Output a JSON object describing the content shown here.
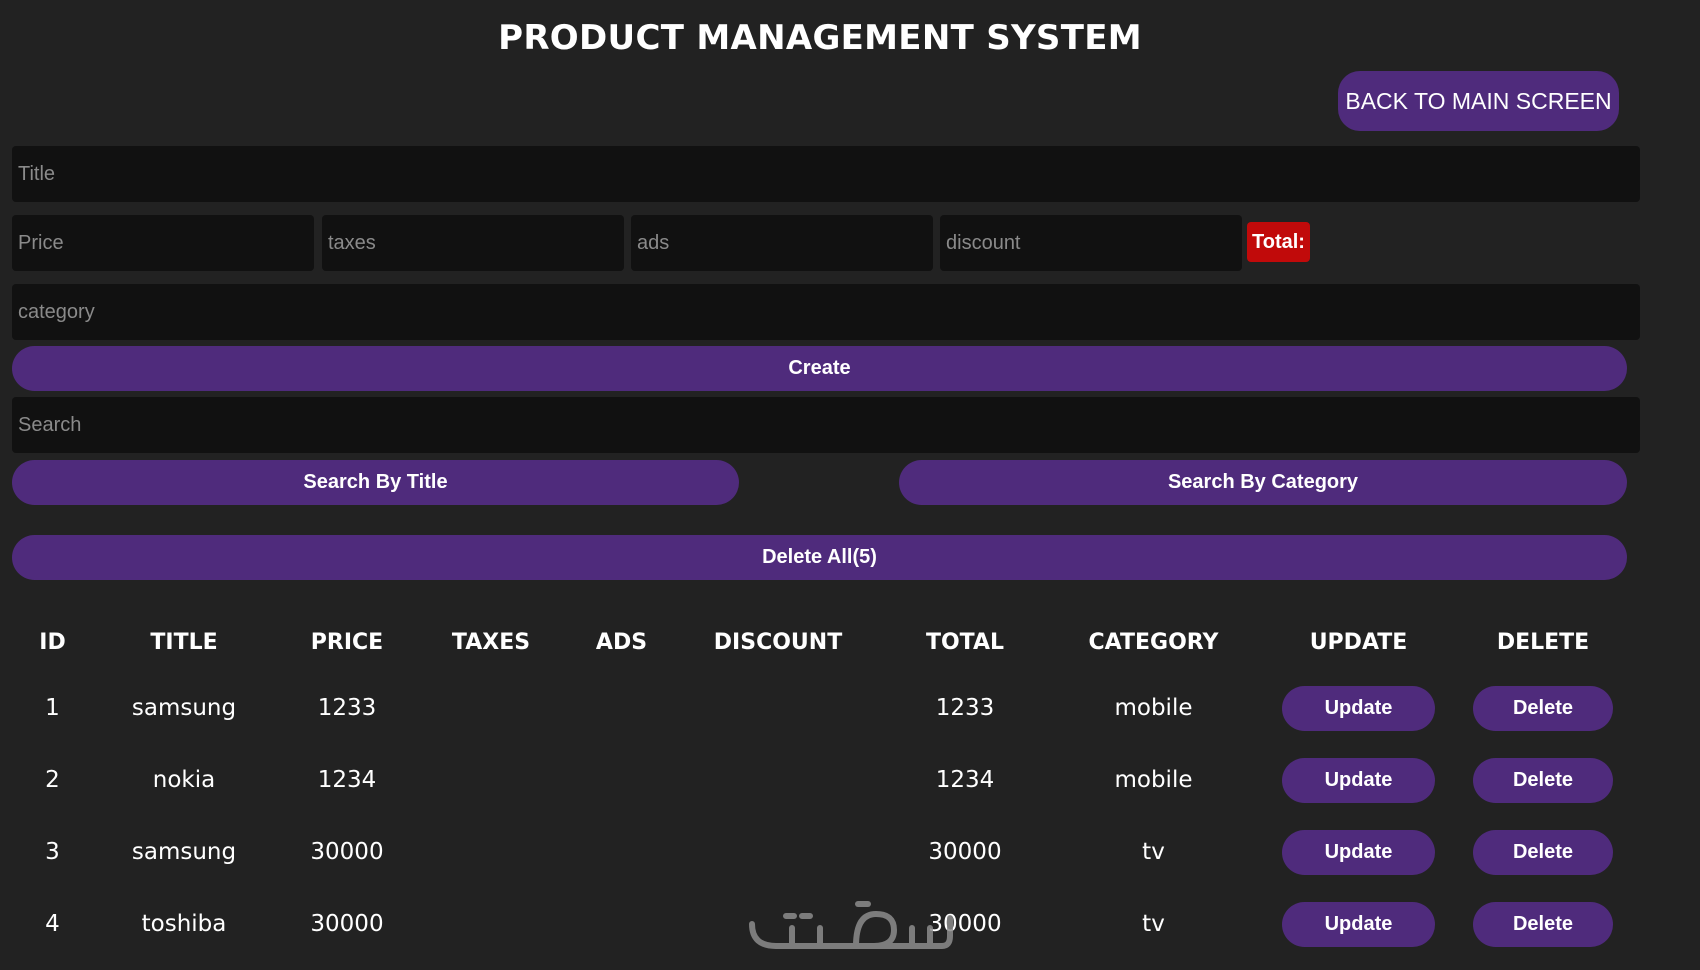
{
  "header": {
    "title": "PRODUCT MANAGEMENT SYSTEM",
    "back_button": "BACK TO MAIN SCREEN"
  },
  "form": {
    "title_placeholder": "Title",
    "price_placeholder": "Price",
    "taxes_placeholder": "taxes",
    "ads_placeholder": "ads",
    "discount_placeholder": "discount",
    "total_label": "Total:",
    "category_placeholder": "category",
    "create_label": "Create"
  },
  "search": {
    "placeholder": "Search",
    "by_title_label": "Search By Title",
    "by_category_label": "Search By Category"
  },
  "delete_all_label": "Delete All(5)",
  "table": {
    "headers": [
      "ID",
      "TITLE",
      "PRICE",
      "TAXES",
      "ADS",
      "DISCOUNT",
      "TOTAL",
      "CATEGORY",
      "UPDATE",
      "DELETE"
    ],
    "rows": [
      {
        "id": "1",
        "title": "samsung",
        "price": "1233",
        "taxes": "",
        "ads": "",
        "discount": "",
        "total": "1233",
        "category": "mobile",
        "update": "Update",
        "delete": "Delete"
      },
      {
        "id": "2",
        "title": "nokia",
        "price": "1234",
        "taxes": "",
        "ads": "",
        "discount": "",
        "total": "1234",
        "category": "mobile",
        "update": "Update",
        "delete": "Delete"
      },
      {
        "id": "3",
        "title": "samsung",
        "price": "30000",
        "taxes": "",
        "ads": "",
        "discount": "",
        "total": "30000",
        "category": "tv",
        "update": "Update",
        "delete": "Delete"
      },
      {
        "id": "4",
        "title": "toshiba",
        "price": "30000",
        "taxes": "",
        "ads": "",
        "discount": "",
        "total": "30000",
        "category": "tv",
        "update": "Update",
        "delete": "Delete"
      }
    ]
  },
  "watermark": {
    "text": "خمسات",
    "icon": "khamsat-logo"
  },
  "colors": {
    "background": "#222222",
    "field_background": "#111111",
    "button_purple": "#4f2b7c",
    "total_red": "#c10a0a",
    "watermark_gray": "#8c8c8c"
  }
}
